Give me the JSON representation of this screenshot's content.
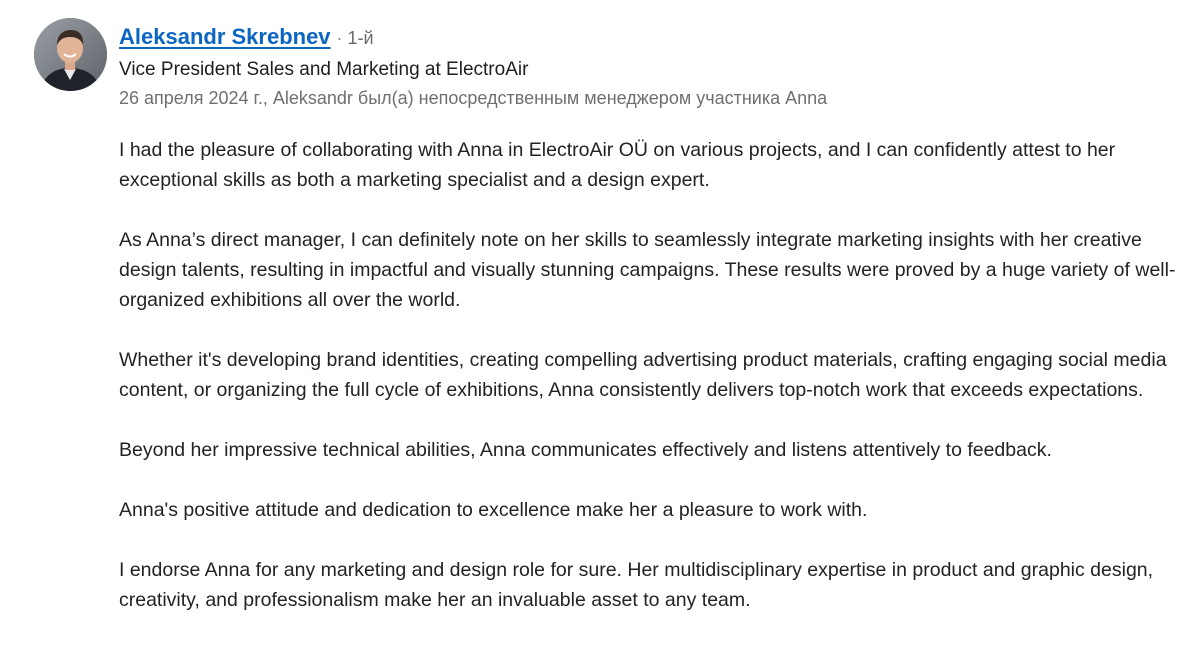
{
  "recommendation": {
    "author": {
      "name": "Aleksandr Skrebnev",
      "degree": "1-й",
      "headline": "Vice President Sales and Marketing at ElectroAir",
      "avatar_icon": "person-photo"
    },
    "meta": "26 апреля 2024 г., Aleksandr был(а) непосредственным менеджером участника Anna",
    "paragraphs": [
      "I had the pleasure of collaborating with Anna in ElectroAir OÜ on various projects, and I can confidently attest to her exceptional skills as both a marketing specialist and a design expert.",
      "As Anna’s direct manager, I can definitely note on her skills to seamlessly integrate marketing insights with her creative design talents, resulting in impactful and visually stunning campaigns. These results were proved by a huge variety of well-organized exhibitions all over the world.",
      "Whether it's developing brand identities, creating compelling advertising product materials, crafting engaging social media content, or organizing the full cycle of exhibitions, Anna consistently delivers top-notch work that exceeds expectations.",
      "Beyond her impressive technical abilities, Anna communicates effectively and listens attentively to feedback.",
      "Anna's positive attitude and dedication to excellence make her a pleasure to work with.",
      "I endorse Anna for any marketing and design role for sure. Her multidisciplinary expertise in product and graphic design, creativity, and professionalism make her an invaluable asset to any team."
    ]
  },
  "colors": {
    "link": "#0a66c2",
    "text": "#232323",
    "muted": "#6f6f6f"
  }
}
